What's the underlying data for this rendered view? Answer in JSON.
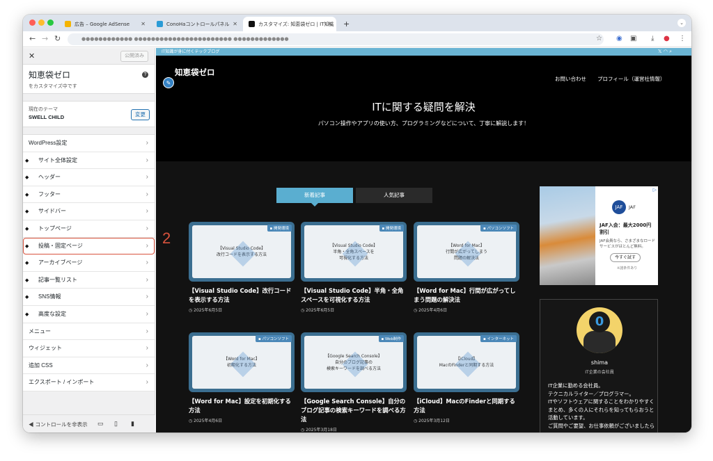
{
  "browser": {
    "tabs": [
      {
        "label": "広告 – Google AdSense",
        "favicon": "adsense-icon"
      },
      {
        "label": "ConoHaコントロールパネル",
        "favicon": "conoha-icon"
      },
      {
        "label": "カスタマイズ: 知恵袋ゼロ | IT知識",
        "favicon": "site-icon"
      }
    ],
    "new_tab": "+",
    "url": "●●●●●●●●●●●● ●●●●●●●●●●●●●●●●●●●●●●● ●●●●●●●●●●●●●"
  },
  "customizer": {
    "close": "✕",
    "publish_label": "公開済み",
    "site_title": "知恵袋ゼロ",
    "site_subtitle": "をカスタマイズ中です",
    "help": "?",
    "theme_label": "現在のテーマ",
    "theme_name": "SWELL CHILD",
    "change_label": "変更",
    "menu": [
      {
        "label": "WordPress設定",
        "icon": false
      },
      {
        "label": "サイト全体設定",
        "icon": true
      },
      {
        "label": "ヘッダー",
        "icon": true
      },
      {
        "label": "フッター",
        "icon": true
      },
      {
        "label": "サイドバー",
        "icon": true
      },
      {
        "label": "トップページ",
        "icon": true
      },
      {
        "label": "投稿・固定ページ",
        "icon": true,
        "highlight": true
      },
      {
        "label": "アーカイブページ",
        "icon": true
      },
      {
        "label": "記事一覧リスト",
        "icon": true
      },
      {
        "label": "SNS情報",
        "icon": true
      },
      {
        "label": "高度な設定",
        "icon": true
      },
      {
        "label": "メニュー",
        "icon": false
      },
      {
        "label": "ウィジェット",
        "icon": false
      },
      {
        "label": "追加 CSS",
        "icon": false
      },
      {
        "label": "エクスポート / インポート",
        "icon": false
      }
    ],
    "hide_controls": "コントロールを非表示"
  },
  "annotation": "2",
  "site": {
    "tagline": "IT知識が身に付くテックブログ",
    "logo": "知恵袋ゼロ",
    "nav": [
      "お問い合わせ",
      "プロフィール（運営社情報）"
    ],
    "hero_title": "ITに関する疑問を解決",
    "hero_sub": "パソコン操作やアプリの使い方、プログラミングなどについて、丁寧に解説します！",
    "tabs": [
      "新着記事",
      "人気記事"
    ],
    "posts": [
      {
        "thumb_t1": "【Visual Studio Code】",
        "thumb_t2": "改行コードを表示する方法",
        "badge": "開発環境",
        "title": "【Visual Studio Code】改行コードを表示する方法",
        "date": "2025年6月5日"
      },
      {
        "thumb_t1": "【Visual Studio Code】",
        "thumb_t2": "半角・全角スペースを\n可視化する方法",
        "badge": "開発環境",
        "title": "【Visual Studio Code】半角・全角スペースを可視化する方法",
        "date": "2025年6月5日"
      },
      {
        "thumb_t1": "【Word for Mac】",
        "thumb_t2": "行間が広がってしまう\n問題の解決法",
        "badge": "パソコンソフト",
        "title": "【Word for Mac】行間が広がってしまう問題の解決法",
        "date": "2025年4月6日"
      },
      {
        "thumb_t1": "【Word for Mac】",
        "thumb_t2": "初期化する方法",
        "badge": "パソコンソフト",
        "title": "【Word for Mac】設定を初期化する方法",
        "date": "2025年4月6日"
      },
      {
        "thumb_t1": "【Google Search Console】",
        "thumb_t2": "自分のブログ記事の\n検索キーワードを調べる方法",
        "badge": "Web制作",
        "title": "【Google Search Console】自分のブログ記事の検索キーワードを調べる方法",
        "date": "2025年3月18日"
      },
      {
        "thumb_t1": "【iCloud】",
        "thumb_t2": "MacのFinderと同期する方法",
        "badge": "インターネット",
        "title": "【iCloud】MacのFinderと同期する方法",
        "date": "2025年3月12日"
      }
    ],
    "ad": {
      "brand": "JAF",
      "headline": "JAF入会：最大2000円割引",
      "body": "JAF会員なら、さまざまなロードサービスがほとんど無料。",
      "button": "今すぐ試す",
      "note": "※諸条件あり",
      "choice": "▷"
    },
    "profile": {
      "name": "shima",
      "role": "IT企業の会社員",
      "avatar_glyph": "0",
      "desc": "IT企業に勤める会社員。\nテクニカルライター／プログラマー。\nITやソフトウェアに関することをわかりやすくまとめ、多くの人にそれらを知ってもらおうと活動しています。\nご質問やご要望、お仕事依頼がございましたら"
    }
  }
}
